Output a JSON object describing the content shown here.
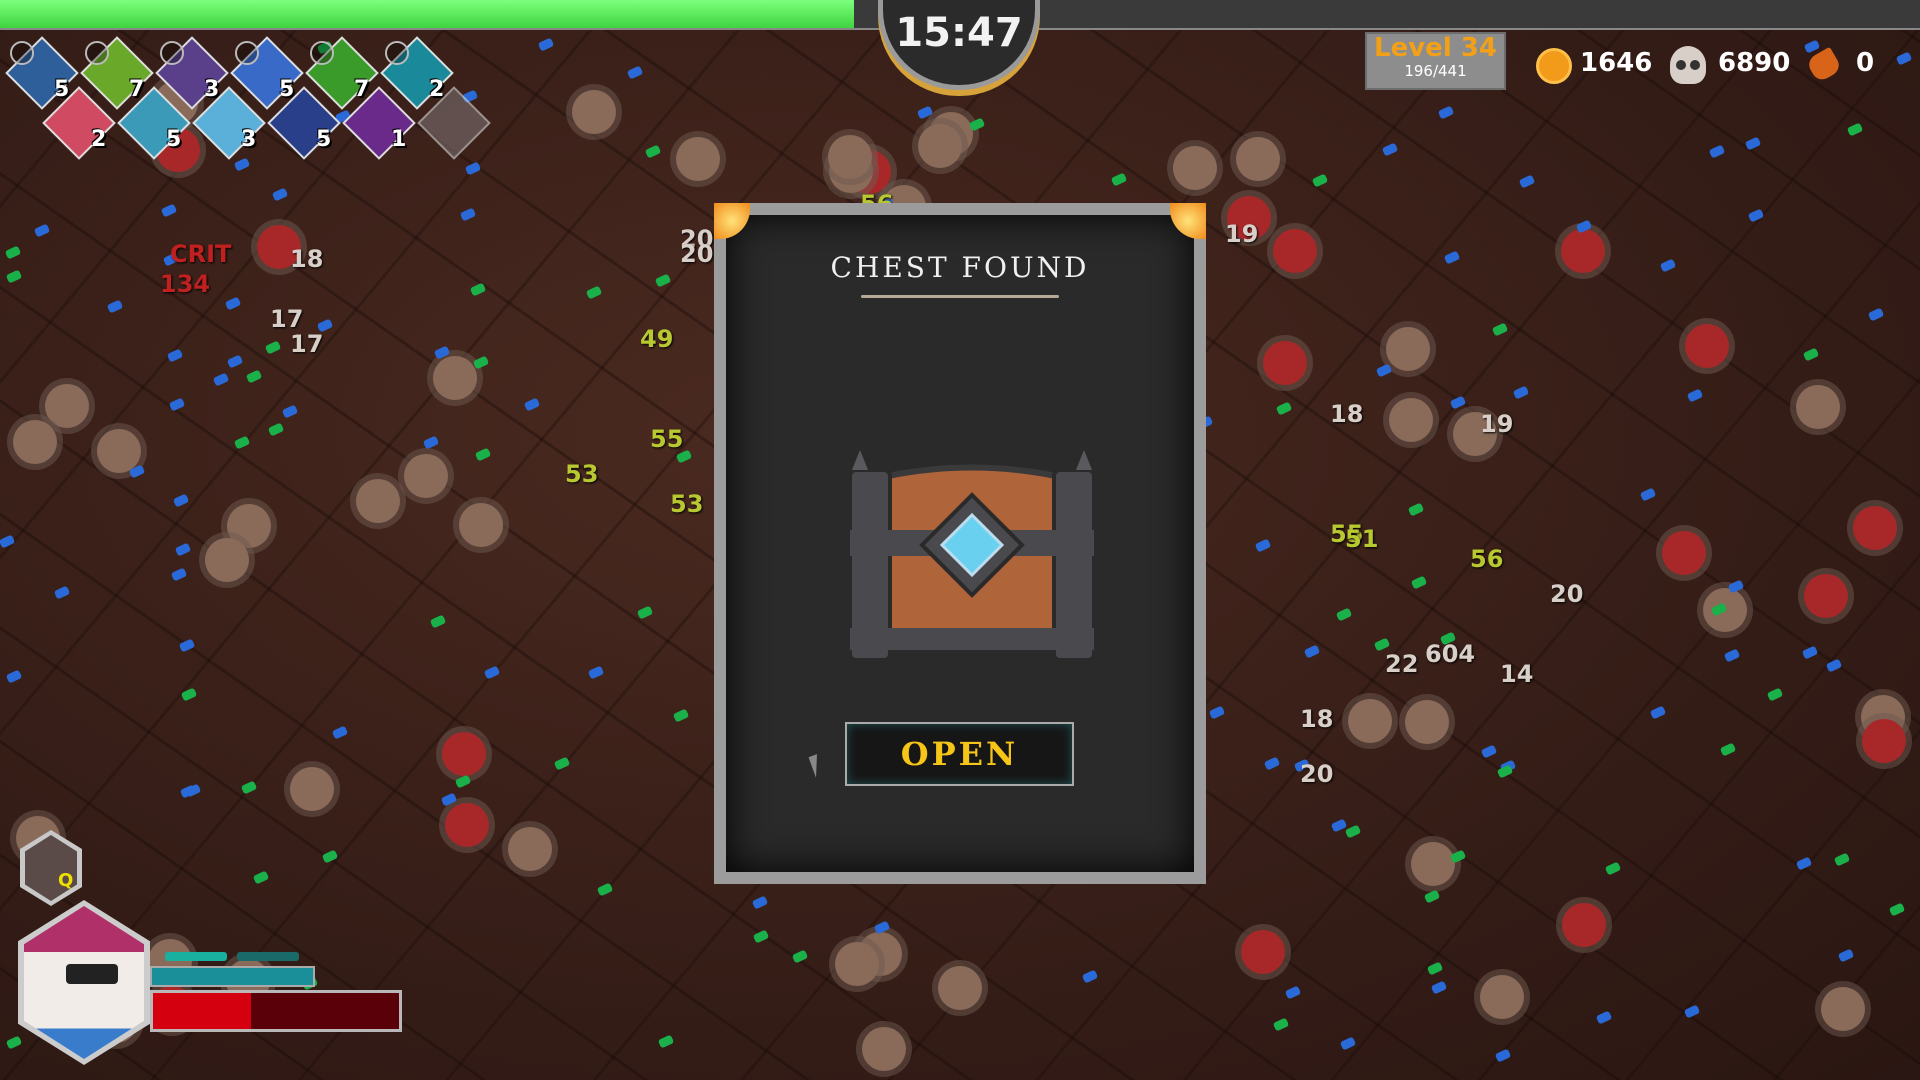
{
  "hud": {
    "timer": "15:47",
    "xp_progress": 0.445,
    "level_label": "Level 34",
    "xp_text": "196/441",
    "gold": "1646",
    "kills": "6890",
    "chests": "0"
  },
  "skills_top": [
    {
      "icon": "sonic-wave-icon",
      "level": "5",
      "color": "#2f5f9a"
    },
    {
      "icon": "turret-icon",
      "level": "7",
      "color": "#6aa82a"
    },
    {
      "icon": "skull-flame-icon",
      "level": "3",
      "color": "#5a3f8a"
    },
    {
      "icon": "energy-orb-icon",
      "level": "5",
      "color": "#3a6ac8"
    },
    {
      "icon": "green-blade-icon",
      "level": "7",
      "color": "#3a9a2a"
    },
    {
      "icon": "wind-slash-icon",
      "level": "2",
      "color": "#1a8a9a"
    }
  ],
  "skills_bottom": [
    {
      "icon": "cookies-icon",
      "level": "2",
      "color": "#d04a62"
    },
    {
      "icon": "stopwatch-icon",
      "level": "5",
      "color": "#3a9ab8"
    },
    {
      "icon": "winged-armor-icon",
      "level": "3",
      "color": "#5ab0d8"
    },
    {
      "icon": "ally-portrait-icon",
      "level": "5",
      "color": "#2a3f8a"
    },
    {
      "icon": "magnet-icon",
      "level": "1",
      "color": "#6a2a8a"
    },
    {
      "icon": "empty-slot-icon",
      "level": "",
      "color": "#7a7070"
    }
  ],
  "dialog": {
    "title": "CHEST FOUND",
    "open_label": "OPEN"
  },
  "player": {
    "ability_key": "Q",
    "health_fraction": 0.4,
    "mana_fraction": 1.0
  },
  "damage_numbers": [
    "CRIT",
    "134",
    "18",
    "17",
    "17",
    "20",
    "20",
    "49",
    "55",
    "53",
    "53",
    "19",
    "18",
    "19",
    "55",
    "56",
    "51",
    "20",
    "22",
    "604",
    "14",
    "18",
    "20",
    "56"
  ]
}
